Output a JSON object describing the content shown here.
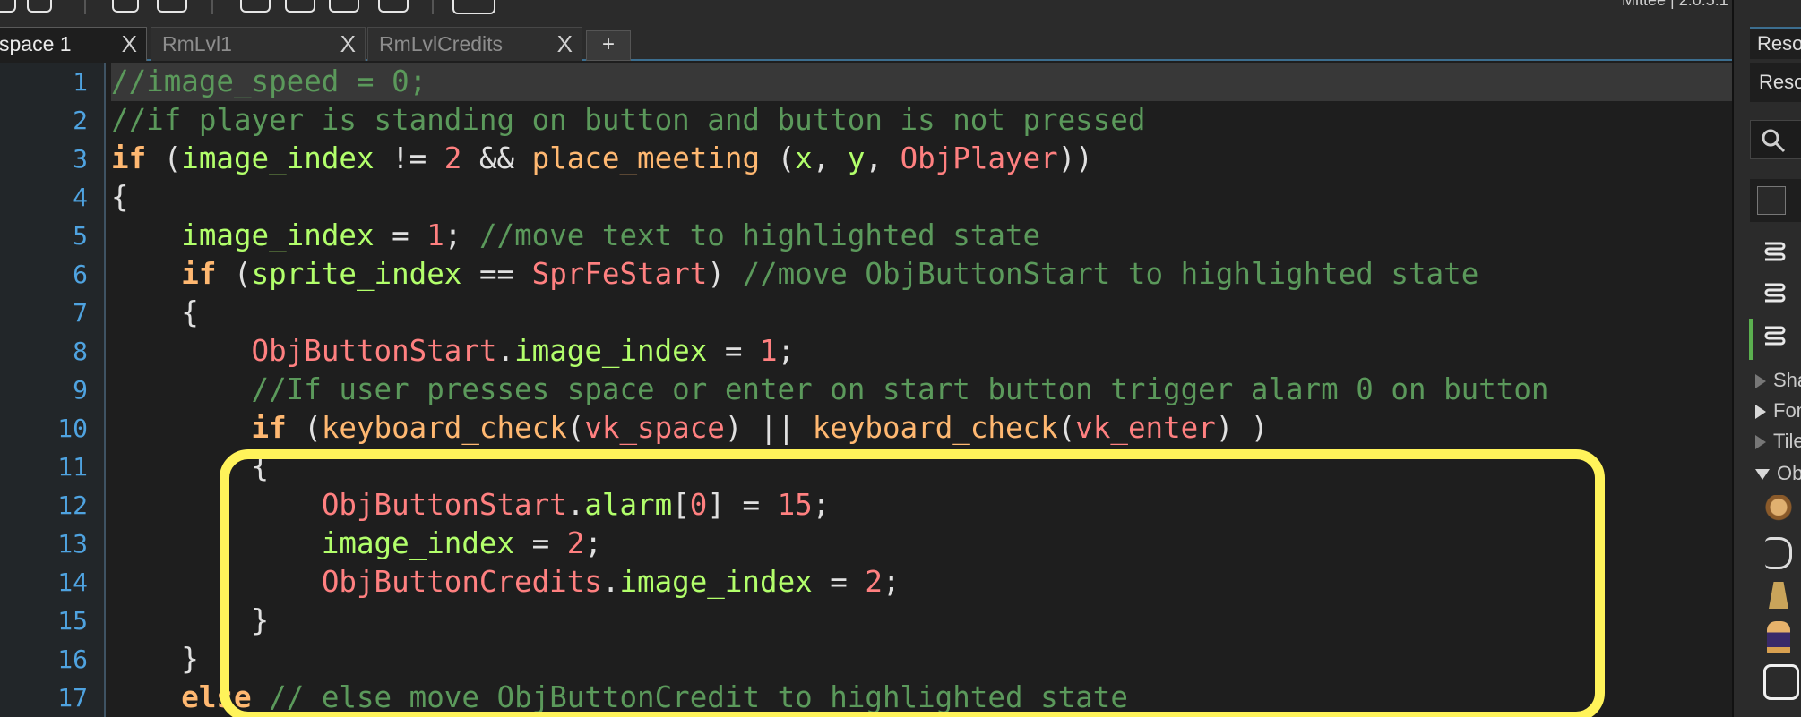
{
  "window": {
    "title_fragment": "Mittee | 2.0.5.1"
  },
  "tabs": [
    {
      "label": "space 1",
      "close": "X",
      "active": true
    },
    {
      "label": "RmLvl1",
      "close": "X",
      "active": false
    },
    {
      "label": "RmLvlCredits",
      "close": "X",
      "active": false
    }
  ],
  "tab_add_label": "+",
  "editor": {
    "line_numbers": [
      "1",
      "2",
      "3",
      "4",
      "5",
      "6",
      "7",
      "8",
      "9",
      "10",
      "11",
      "12",
      "13",
      "14",
      "15",
      "16",
      "17"
    ],
    "code": [
      "//image_speed = 0;",
      "//if player is standing on button and button is not pressed",
      "if (image_index != 2 && place_meeting (x, y, ObjPlayer))",
      "{",
      "    image_index = 1; //move text to highlighted state",
      "    if (sprite_index == SprFeStart) //move ObjButtonStart to highlighted state",
      "    {",
      "        ObjButtonStart.image_index = 1;",
      "        //If user presses space or enter on start button trigger alarm 0 on button",
      "        if (keyboard_check(vk_space) || keyboard_check(vk_enter) )",
      "        {",
      "            ObjButtonStart.alarm[0] = 15;",
      "            image_index = 2;",
      "            ObjButtonCredits.image_index = 2;",
      "        }",
      "    }",
      "    else // else move ObjButtonCredit to highlighted state"
    ]
  },
  "resource_panel": {
    "tab_label": "Resources",
    "header_label": "Resources",
    "search_icon": "search-icon",
    "rows": [
      {
        "label": "Shaders"
      },
      {
        "label": "Fonts"
      },
      {
        "label": "Tile Sets"
      },
      {
        "label": "Objects"
      }
    ]
  },
  "colors": {
    "keyword": "#ffb871",
    "identifier": "#b2ff6b",
    "number": "#ff8080",
    "comment": "#5b995b",
    "line_number": "#4fa3e0",
    "highlight_box": "#fff35a"
  }
}
